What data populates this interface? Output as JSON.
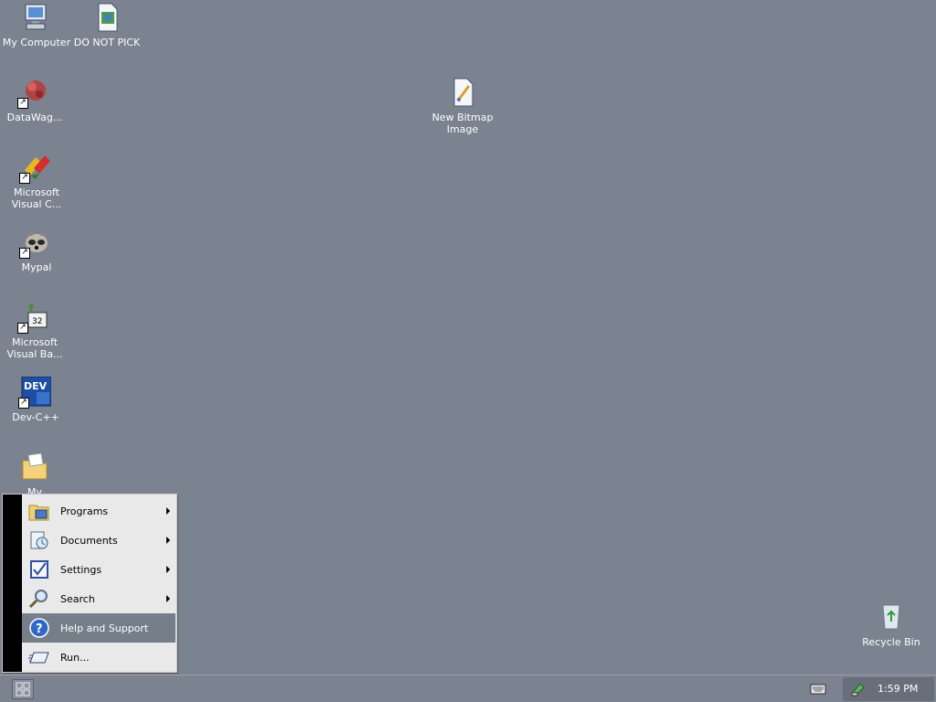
{
  "desktop": {
    "icons": [
      {
        "name": "My Computer"
      },
      {
        "name": "DO NOT PICK"
      },
      {
        "name": "DataWag..."
      },
      {
        "name": "New Bitmap Image"
      },
      {
        "name": "Microsoft Visual C..."
      },
      {
        "name": "Mypal"
      },
      {
        "name": "Microsoft Visual Ba..."
      },
      {
        "name": "Dev-C++"
      },
      {
        "name": "My"
      },
      {
        "name": "Recycle Bin"
      }
    ]
  },
  "start_menu": {
    "items": [
      {
        "label": "Programs",
        "has_submenu": true,
        "icon": "programs-icon"
      },
      {
        "label": "Documents",
        "has_submenu": true,
        "icon": "documents-icon"
      },
      {
        "label": "Settings",
        "has_submenu": true,
        "icon": "settings-icon"
      },
      {
        "label": "Search",
        "has_submenu": true,
        "icon": "search-icon"
      },
      {
        "label": "Help and Support",
        "has_submenu": false,
        "icon": "help-icon",
        "selected": true
      },
      {
        "label": "Run...",
        "has_submenu": false,
        "icon": "run-icon"
      }
    ]
  },
  "taskbar": {
    "clock": "1:59 PM"
  },
  "colors": {
    "desktop_background": "#7b8290",
    "menu_background": "#e9e9e9",
    "menu_highlight": "#767e8a"
  }
}
